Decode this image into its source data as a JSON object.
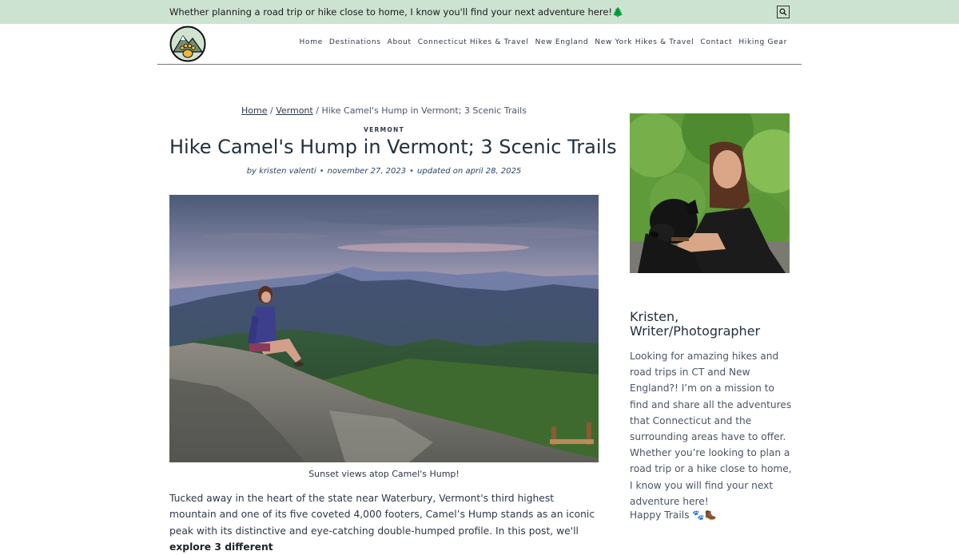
{
  "topbar": {
    "tagline": "Whether planning a road trip or hike close to home, I know you'll find your next adventure here!",
    "tagline_emoji": "🌲",
    "search_icon": "search-icon"
  },
  "header": {
    "logo_icon": "mountain-paw-logo",
    "nav": [
      "Home",
      "Destinations",
      "About",
      "Connecticut Hikes & Travel",
      "New England",
      "New York Hikes & Travel",
      "Contact",
      "Hiking Gear"
    ]
  },
  "breadcrumb": {
    "home": "Home",
    "sep": "/",
    "vermont": "Vermont",
    "current": "Hike Camel's Hump in Vermont; 3 Scenic Trails"
  },
  "post": {
    "category": "VERMONT",
    "title": "Hike Camel's Hump in Vermont; 3 Scenic Trails",
    "author": "by kristen valenti",
    "date": "november 27, 2023",
    "updated": "updated on april 28, 2025",
    "bullet": "•",
    "hero_caption": "Sunset views atop Camel's Hump!",
    "intro_text": "Tucked away in the heart of the state near Waterbury, Vermont's third highest mountain and one of its five coveted 4,000 footers, Camel’s Hump stands as an iconic peak with its distinctive and eye-catching double-humped profile. In this post, we'll ",
    "intro_bold": "explore 3 different"
  },
  "sidebar": {
    "name": "Kristen, Writer/Photographer",
    "bio": "Looking for amazing hikes and road trips in CT and New England?! I’m on a mission to find and share all the adventures that Connecticut and the surrounding areas have to offer. Whether you’re looking to plan a road trip or a hike close to home, I know you will find your next adventure here!",
    "signoff": "Happy Trails 🐾🥾"
  },
  "colors": {
    "topbar_bg": "#cde3d1",
    "text": "#2d3748",
    "meta": "#2a4365"
  }
}
